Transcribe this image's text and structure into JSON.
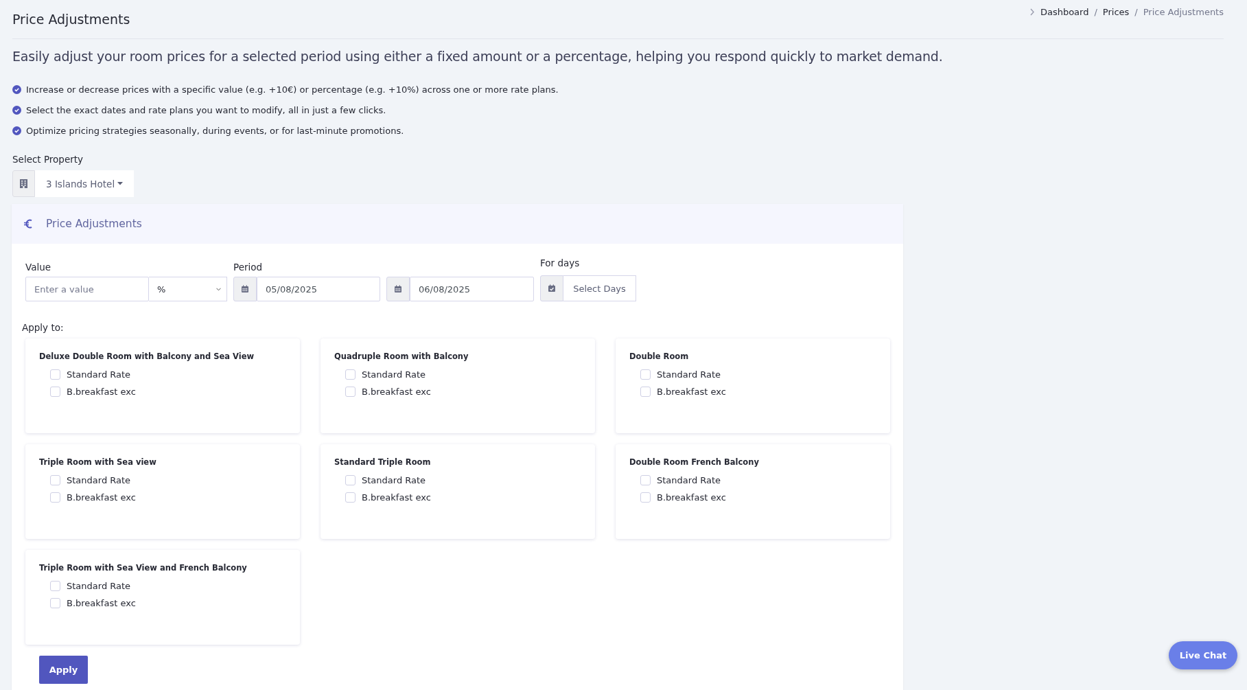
{
  "page": {
    "title": "Price Adjustments"
  },
  "breadcrumb": [
    {
      "label": "Dashboard",
      "current": false
    },
    {
      "separator": "/",
      "label": "Prices",
      "current": false
    },
    {
      "separator": "/",
      "label": "Price Adjustments",
      "current": true
    }
  ],
  "intro": "Easily adjust your room prices for a selected period using either a fixed amount or a percentage, helping you respond quickly to market demand.",
  "features": [
    "Increase or decrease prices with a specific value (e.g. +10€) or percentage (e.g. +10%) across one or more rate plans.",
    "Select the exact dates and rate plans you want to modify, all in just a few clicks.",
    "Optimize pricing strategies seasonally, during events, or for last-minute promotions."
  ],
  "property": {
    "label": "Select Property",
    "value": "3 Islands Hotel"
  },
  "panel": {
    "title": "Price Adjustments",
    "value": {
      "label": "Value",
      "placeholder": "Enter a value",
      "unit": "%"
    },
    "period": {
      "label": "Period",
      "from": "05/08/2025",
      "to": "06/08/2025"
    },
    "days": {
      "label": "For days",
      "button": "Select Days"
    },
    "apply_to": "Apply to:",
    "rooms": [
      {
        "name": "Deluxe Double Room with Balcony and Sea View",
        "rates": [
          {
            "label": "Standard Rate",
            "checked": false
          },
          {
            "label": "B.breakfast exc",
            "checked": false
          }
        ]
      },
      {
        "name": "Quadruple Room with Balcony",
        "rates": [
          {
            "label": "Standard Rate",
            "checked": false
          },
          {
            "label": "B.breakfast exc",
            "checked": false
          }
        ]
      },
      {
        "name": "Double Room",
        "rates": [
          {
            "label": "Standard Rate",
            "checked": false
          },
          {
            "label": "B.breakfast exc",
            "checked": false
          }
        ]
      },
      {
        "name": "Triple Room with Sea view",
        "rates": [
          {
            "label": "Standard Rate",
            "checked": false
          },
          {
            "label": "B.breakfast exc",
            "checked": false
          }
        ]
      },
      {
        "name": "Standard Triple Room",
        "rates": [
          {
            "label": "Standard Rate",
            "checked": false
          },
          {
            "label": "B.breakfast exc",
            "checked": false
          }
        ]
      },
      {
        "name": "Double Room French Balcony",
        "rates": [
          {
            "label": "Standard Rate",
            "checked": false
          },
          {
            "label": "B.breakfast exc",
            "checked": false
          }
        ]
      },
      {
        "name": "Triple Room with Sea View and French Balcony",
        "rates": [
          {
            "label": "Standard Rate",
            "checked": false
          },
          {
            "label": "B.breakfast exc",
            "checked": false
          }
        ]
      }
    ],
    "apply_button": "Apply"
  },
  "live_chat": "Live Chat"
}
